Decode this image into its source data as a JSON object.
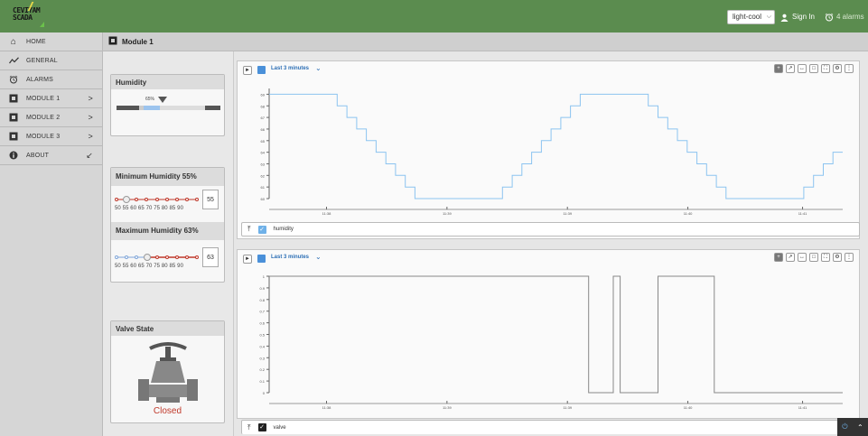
{
  "app": {
    "logo_line1": "CEVIYAM",
    "logo_line2": "SCADA"
  },
  "topbar": {
    "theme": "light-cool",
    "signin": "Sign In",
    "alarms": "4 alarms"
  },
  "sidebar": {
    "items": [
      {
        "label": "HOME",
        "icon": "home-icon",
        "arrow": ""
      },
      {
        "label": "GENERAL",
        "icon": "trend-icon",
        "arrow": ""
      },
      {
        "label": "ALARMS",
        "icon": "alarm-clock-icon",
        "arrow": ""
      },
      {
        "label": "MODULE 1",
        "icon": "module-icon",
        "arrow": ">"
      },
      {
        "label": "MODULE 2",
        "icon": "module-icon",
        "arrow": ">"
      },
      {
        "label": "MODULE 3",
        "icon": "module-icon",
        "arrow": ">"
      },
      {
        "label": "ABOUT",
        "icon": "info-icon",
        "arrow": "↙"
      }
    ]
  },
  "page": {
    "title": "Module 1"
  },
  "humidity": {
    "title": "Humidity",
    "value_label": "65%",
    "value_fraction": 0.65
  },
  "minmax": {
    "min_title": "Minimum Humidity 55%",
    "min_value": "55",
    "max_title": "Maximum Humidity 63%",
    "max_value": "63",
    "scale_labels": "50  55  60  65  70  75  80  85  90"
  },
  "valve": {
    "title": "Valve State",
    "state": "Closed",
    "state_color": "#c0392b"
  },
  "panel1": {
    "range": "Last 3 minutes",
    "legend": "humidity",
    "legend_color": "#6fb1e8"
  },
  "panel2": {
    "range": "Last 3 minutes",
    "legend": "valve",
    "legend_color": "#222222"
  },
  "chart_data": [
    {
      "type": "line",
      "series": [
        {
          "name": "humidity",
          "color": "#8cc4f0"
        }
      ],
      "x_ticks": [
        "11:38",
        "11:39",
        "11:39",
        "11:40",
        "11:41"
      ],
      "y_ticks": [
        "60",
        "61",
        "62",
        "63",
        "64",
        "65",
        "66",
        "67",
        "68",
        "69"
      ],
      "ylim": [
        60,
        69.5
      ],
      "values": [
        69,
        69,
        69,
        69,
        69,
        69,
        69,
        68,
        67,
        66,
        65,
        64,
        63,
        62,
        61,
        60,
        60,
        60,
        60,
        60,
        60,
        60,
        60,
        60,
        61,
        62,
        63,
        64,
        65,
        66,
        67,
        68,
        69,
        69,
        69,
        69,
        69,
        69,
        69,
        68,
        67,
        66,
        65,
        64,
        63,
        62,
        61,
        60,
        60,
        60,
        60,
        60,
        60,
        60,
        60,
        61,
        62,
        63,
        64
      ]
    },
    {
      "type": "line",
      "series": [
        {
          "name": "valve",
          "color": "#888888"
        }
      ],
      "x_ticks": [
        "11:38",
        "11:39",
        "11:39",
        "11:40",
        "11:41"
      ],
      "y_ticks": [
        "0",
        "0.1",
        "0.2",
        "0.3",
        "0.4",
        "0.5",
        "0.6",
        "0.7",
        "0.8",
        "0.9",
        "1"
      ],
      "ylim": [
        0,
        1
      ],
      "steps": [
        [
          0,
          1
        ],
        [
          0.557,
          1
        ],
        [
          0.557,
          0
        ],
        [
          0.6,
          0
        ],
        [
          0.6,
          1
        ],
        [
          0.612,
          1
        ],
        [
          0.612,
          0
        ],
        [
          0.678,
          0
        ],
        [
          0.678,
          1
        ],
        [
          0.776,
          1
        ],
        [
          0.776,
          0
        ],
        [
          1.0,
          0
        ]
      ]
    }
  ]
}
